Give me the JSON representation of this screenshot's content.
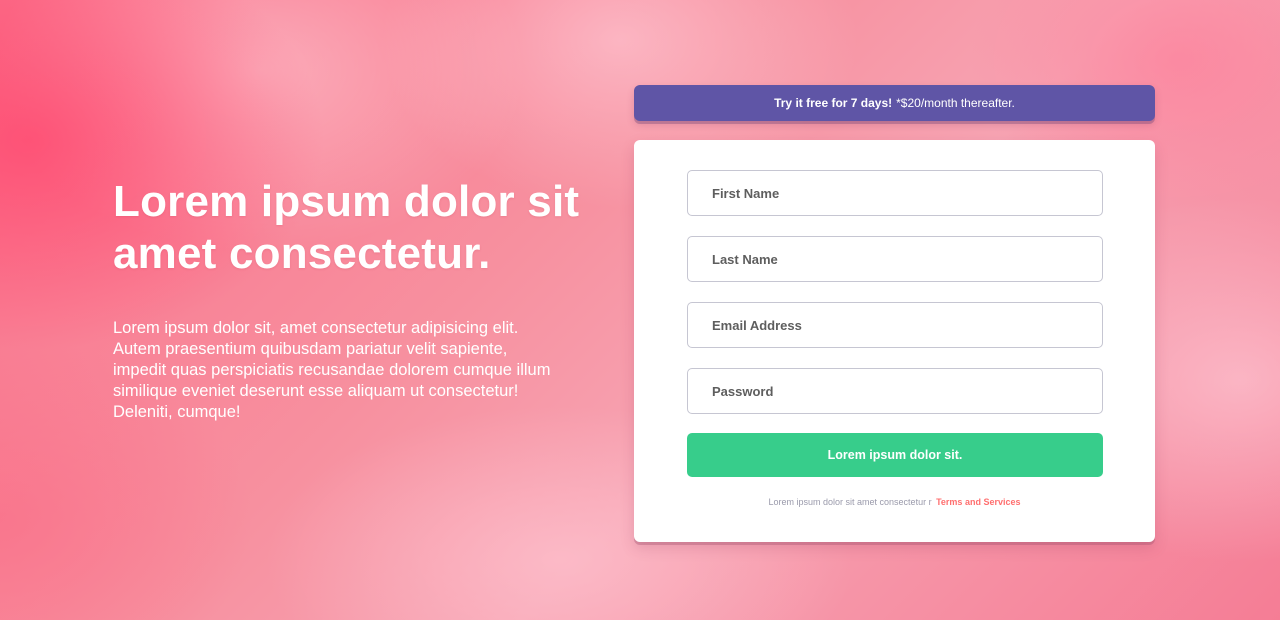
{
  "hero": {
    "title": "Lorem ipsum dolor sit amet consectetur.",
    "text": "Lorem ipsum dolor sit, amet consectetur adipisicing elit. Autem praesentium quibusdam pariatur velit sapiente, impedit quas perspiciatis recusandae dolorem cumque illum similique eveniet deserunt esse aliquam ut consectetur! Deleniti, cumque!"
  },
  "banner": {
    "bold": "Try it free for 7 days!",
    "rest": "*$20/month thereafter."
  },
  "form": {
    "first_name_placeholder": "First Name",
    "last_name_placeholder": "Last Name",
    "email_placeholder": "Email Address",
    "password_placeholder": "Password",
    "submit_label": "Lorem ipsum dolor sit.",
    "terms_text": "Lorem ipsum dolor sit amet consectetur r",
    "terms_link": "Terms and Services"
  },
  "colors": {
    "banner": "#5f55a6",
    "submit": "#37cd8b",
    "terms_link": "#ff6f6f"
  }
}
